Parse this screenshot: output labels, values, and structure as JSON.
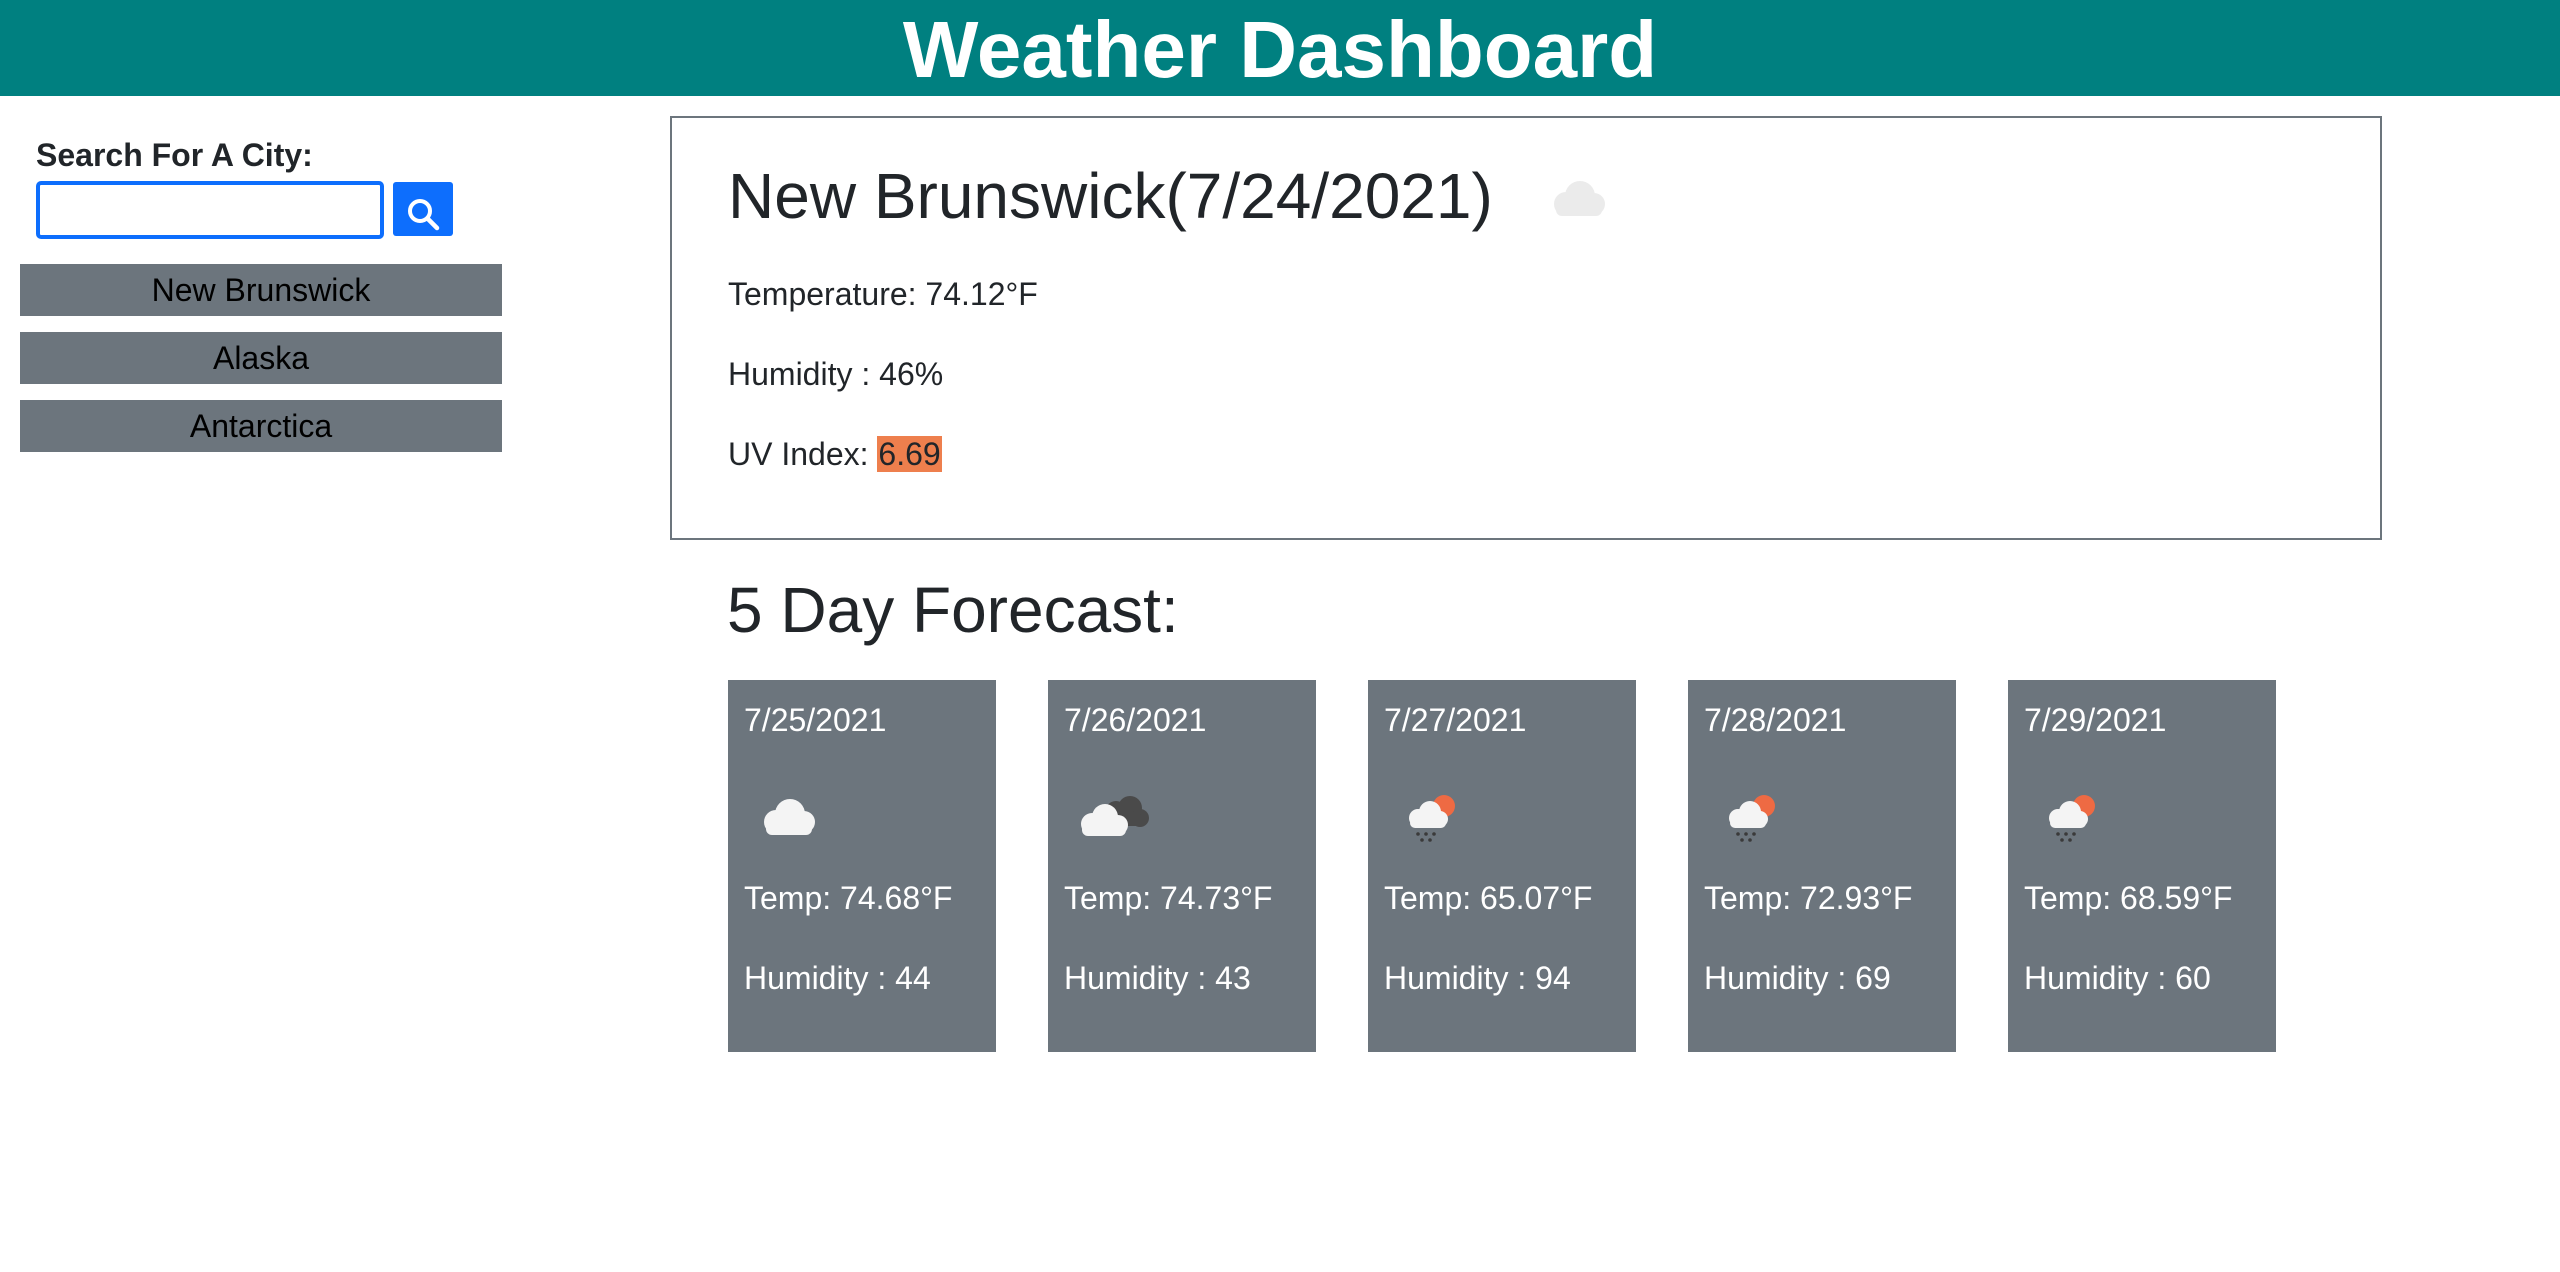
{
  "header": {
    "title": "Weather Dashboard"
  },
  "search": {
    "label": "Search For A City:",
    "value": "",
    "placeholder": "",
    "button_icon": "search-icon"
  },
  "history": [
    "New Brunswick",
    "Alaska",
    "Antarctica"
  ],
  "current": {
    "title": "New Brunswick(7/24/2021)",
    "icon": "cloud-icon",
    "temperature": "Temperature: 74.12°F",
    "humidity": "Humidity : 46%",
    "uv_label": "UV Index: ",
    "uv_value": "6.69",
    "uv_color": "#ee7f4d"
  },
  "forecast": {
    "title": "5 Day Forecast:",
    "days": [
      {
        "date": "7/25/2021",
        "icon": "cloud-icon",
        "temp": "Temp: 74.68°F",
        "humidity": "Humidity : 44"
      },
      {
        "date": "7/26/2021",
        "icon": "broken-clouds-icon",
        "temp": "Temp: 74.73°F",
        "humidity": "Humidity : 43"
      },
      {
        "date": "7/27/2021",
        "icon": "sun-rain-icon",
        "temp": "Temp: 65.07°F",
        "humidity": "Humidity : 94"
      },
      {
        "date": "7/28/2021",
        "icon": "sun-rain-icon",
        "temp": "Temp: 72.93°F",
        "humidity": "Humidity : 69"
      },
      {
        "date": "7/29/2021",
        "icon": "sun-rain-icon",
        "temp": "Temp: 68.59°F",
        "humidity": "Humidity : 60"
      }
    ]
  },
  "colors": {
    "header": "#008080",
    "accent": "#0d6efd",
    "card": "#6c757d"
  }
}
